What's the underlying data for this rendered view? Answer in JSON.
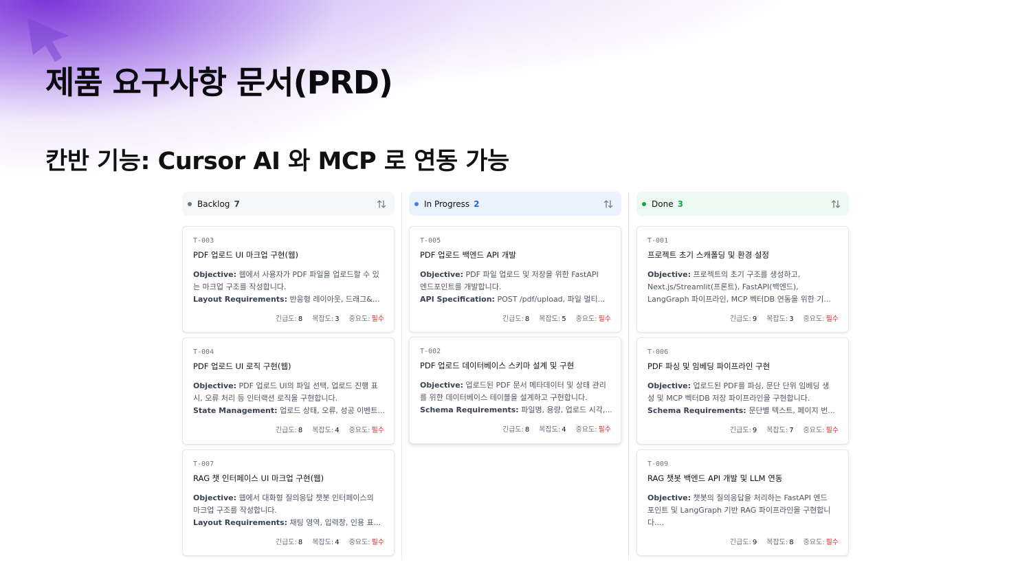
{
  "slide": {
    "title": "제품 요구사항 문서(PRD)",
    "subtitle": "칸반 기능: Cursor AI 와 MCP 로 연동 가능"
  },
  "colors": {
    "backlog": "#6b7280",
    "in_progress": "#3b82f6",
    "done": "#16a34a",
    "backlog_bg": "#f6f7f9",
    "in_progress_bg": "#eaf2fd",
    "done_bg": "#ecfaf1",
    "required": "#dc2626",
    "accent_purple": "#7c3aed"
  },
  "labels": {
    "urgency": "긴급도:",
    "complexity": "복잡도:",
    "importance": "중요도:"
  },
  "columns": [
    {
      "name": "Backlog",
      "count": "7",
      "cards": [
        {
          "id": "T-003",
          "title": "PDF 업로드 UI 마크업 구현(웹)",
          "l1_label": "Objective:",
          "l1_text": " 웹에서 사용자가 PDF 파일을 업로드할 수 있",
          "l2_text": "는 마크업 구조를 작성합니다.",
          "l3_label": "Layout Requirements:",
          "l3_text": " 반응형 레이아웃, 드래그&드...",
          "urgency": "8",
          "complexity": "3",
          "importance": "필수"
        },
        {
          "id": "T-004",
          "title": "PDF 업로드 UI 로직 구현(웹)",
          "l1_label": "Objective:",
          "l1_text": " PDF 업로드 UI의 파일 선택, 업로드 진행 표",
          "l2_text": "시, 오류 처리 등 인터랙션 로직을 구현합니다.",
          "l3_label": "State Management:",
          "l3_text": " 업로드 상태, 오류, 성공 이벤트...",
          "urgency": "8",
          "complexity": "4",
          "importance": "필수"
        },
        {
          "id": "T-007",
          "title": "RAG 챗 인터페이스 UI 마크업 구현(웹)",
          "l1_label": "Objective:",
          "l1_text": " 웹에서 대화형 질의응답 챗봇 인터페이스의",
          "l2_text": "마크업 구조를 작성합니다.",
          "l3_label": "Layout Requirements:",
          "l3_text": " 채팅 영역, 입력창, 인용 표...",
          "urgency": "8",
          "complexity": "4",
          "importance": "필수"
        }
      ]
    },
    {
      "name": "In Progress",
      "count": "2",
      "cards": [
        {
          "id": "T-005",
          "title": "PDF 업로드 백엔드 API 개발",
          "l1_label": "Objective:",
          "l1_text": " PDF 파일 업로드 및 저장을 위한 FastAPI",
          "l2_text": "엔드포인트를 개발합니다.",
          "l3_label": "API Specification:",
          "l3_text": " POST /pdf/upload, 파일 멀티...",
          "urgency": "8",
          "complexity": "5",
          "importance": "필수"
        },
        {
          "id": "T-002",
          "title": "PDF 업로드 데이터베이스 스키마 설계 및 구현",
          "l1_label": "Objective:",
          "l1_text": " 업로드된 PDF 문서 메타데이터 및 상태 관리",
          "l2_text": "를 위한 데이터베이스 테이블을 설계하고 구현합니다.",
          "l3_label": "Schema Requirements:",
          "l3_text": " 파일명, 용량, 업로드 시각,...",
          "urgency": "8",
          "complexity": "4",
          "importance": "필수"
        }
      ]
    },
    {
      "name": "Done",
      "count": "3",
      "cards": [
        {
          "id": "T-001",
          "title": "프로젝트 초기 스캐폴딩 및 환경 설정",
          "l1_label": "Objective:",
          "l1_text": " 프로젝트의 초기 구조를 생성하고,",
          "l2_text": "Next.js/Streamlit(프론트), FastAPI(백엔드),",
          "l3_label": "",
          "l3_text": "LangGraph 파이프라인, MCP 벡터DB 연동을 위한 기...",
          "urgency": "9",
          "complexity": "3",
          "importance": "필수"
        },
        {
          "id": "T-006",
          "title": "PDF 파싱 및 임베딩 파이프라인 구현",
          "l1_label": "Objective:",
          "l1_text": " 업로드된 PDF를 파싱, 문단 단위 임베딩 생",
          "l2_text": "성 및 MCP 벡터DB 저장 파이프라인을 구현합니다.",
          "l3_label": "Schema Requirements:",
          "l3_text": " 문단별 텍스트, 페이지 번...",
          "urgency": "9",
          "complexity": "7",
          "importance": "필수"
        },
        {
          "id": "T-009",
          "title": "RAG 챗봇 백엔드 API 개발 및 LLM 연동",
          "l1_label": "Objective:",
          "l1_text": " 챗봇의 질의응답을 처리하는 FastAPI 엔드",
          "l2_text": "포인트 및 LangGraph 기반 RAG 파이프라인을 구현합니",
          "l3_label": "",
          "l3_text": "다....",
          "urgency": "9",
          "complexity": "8",
          "importance": "필수"
        }
      ]
    }
  ]
}
